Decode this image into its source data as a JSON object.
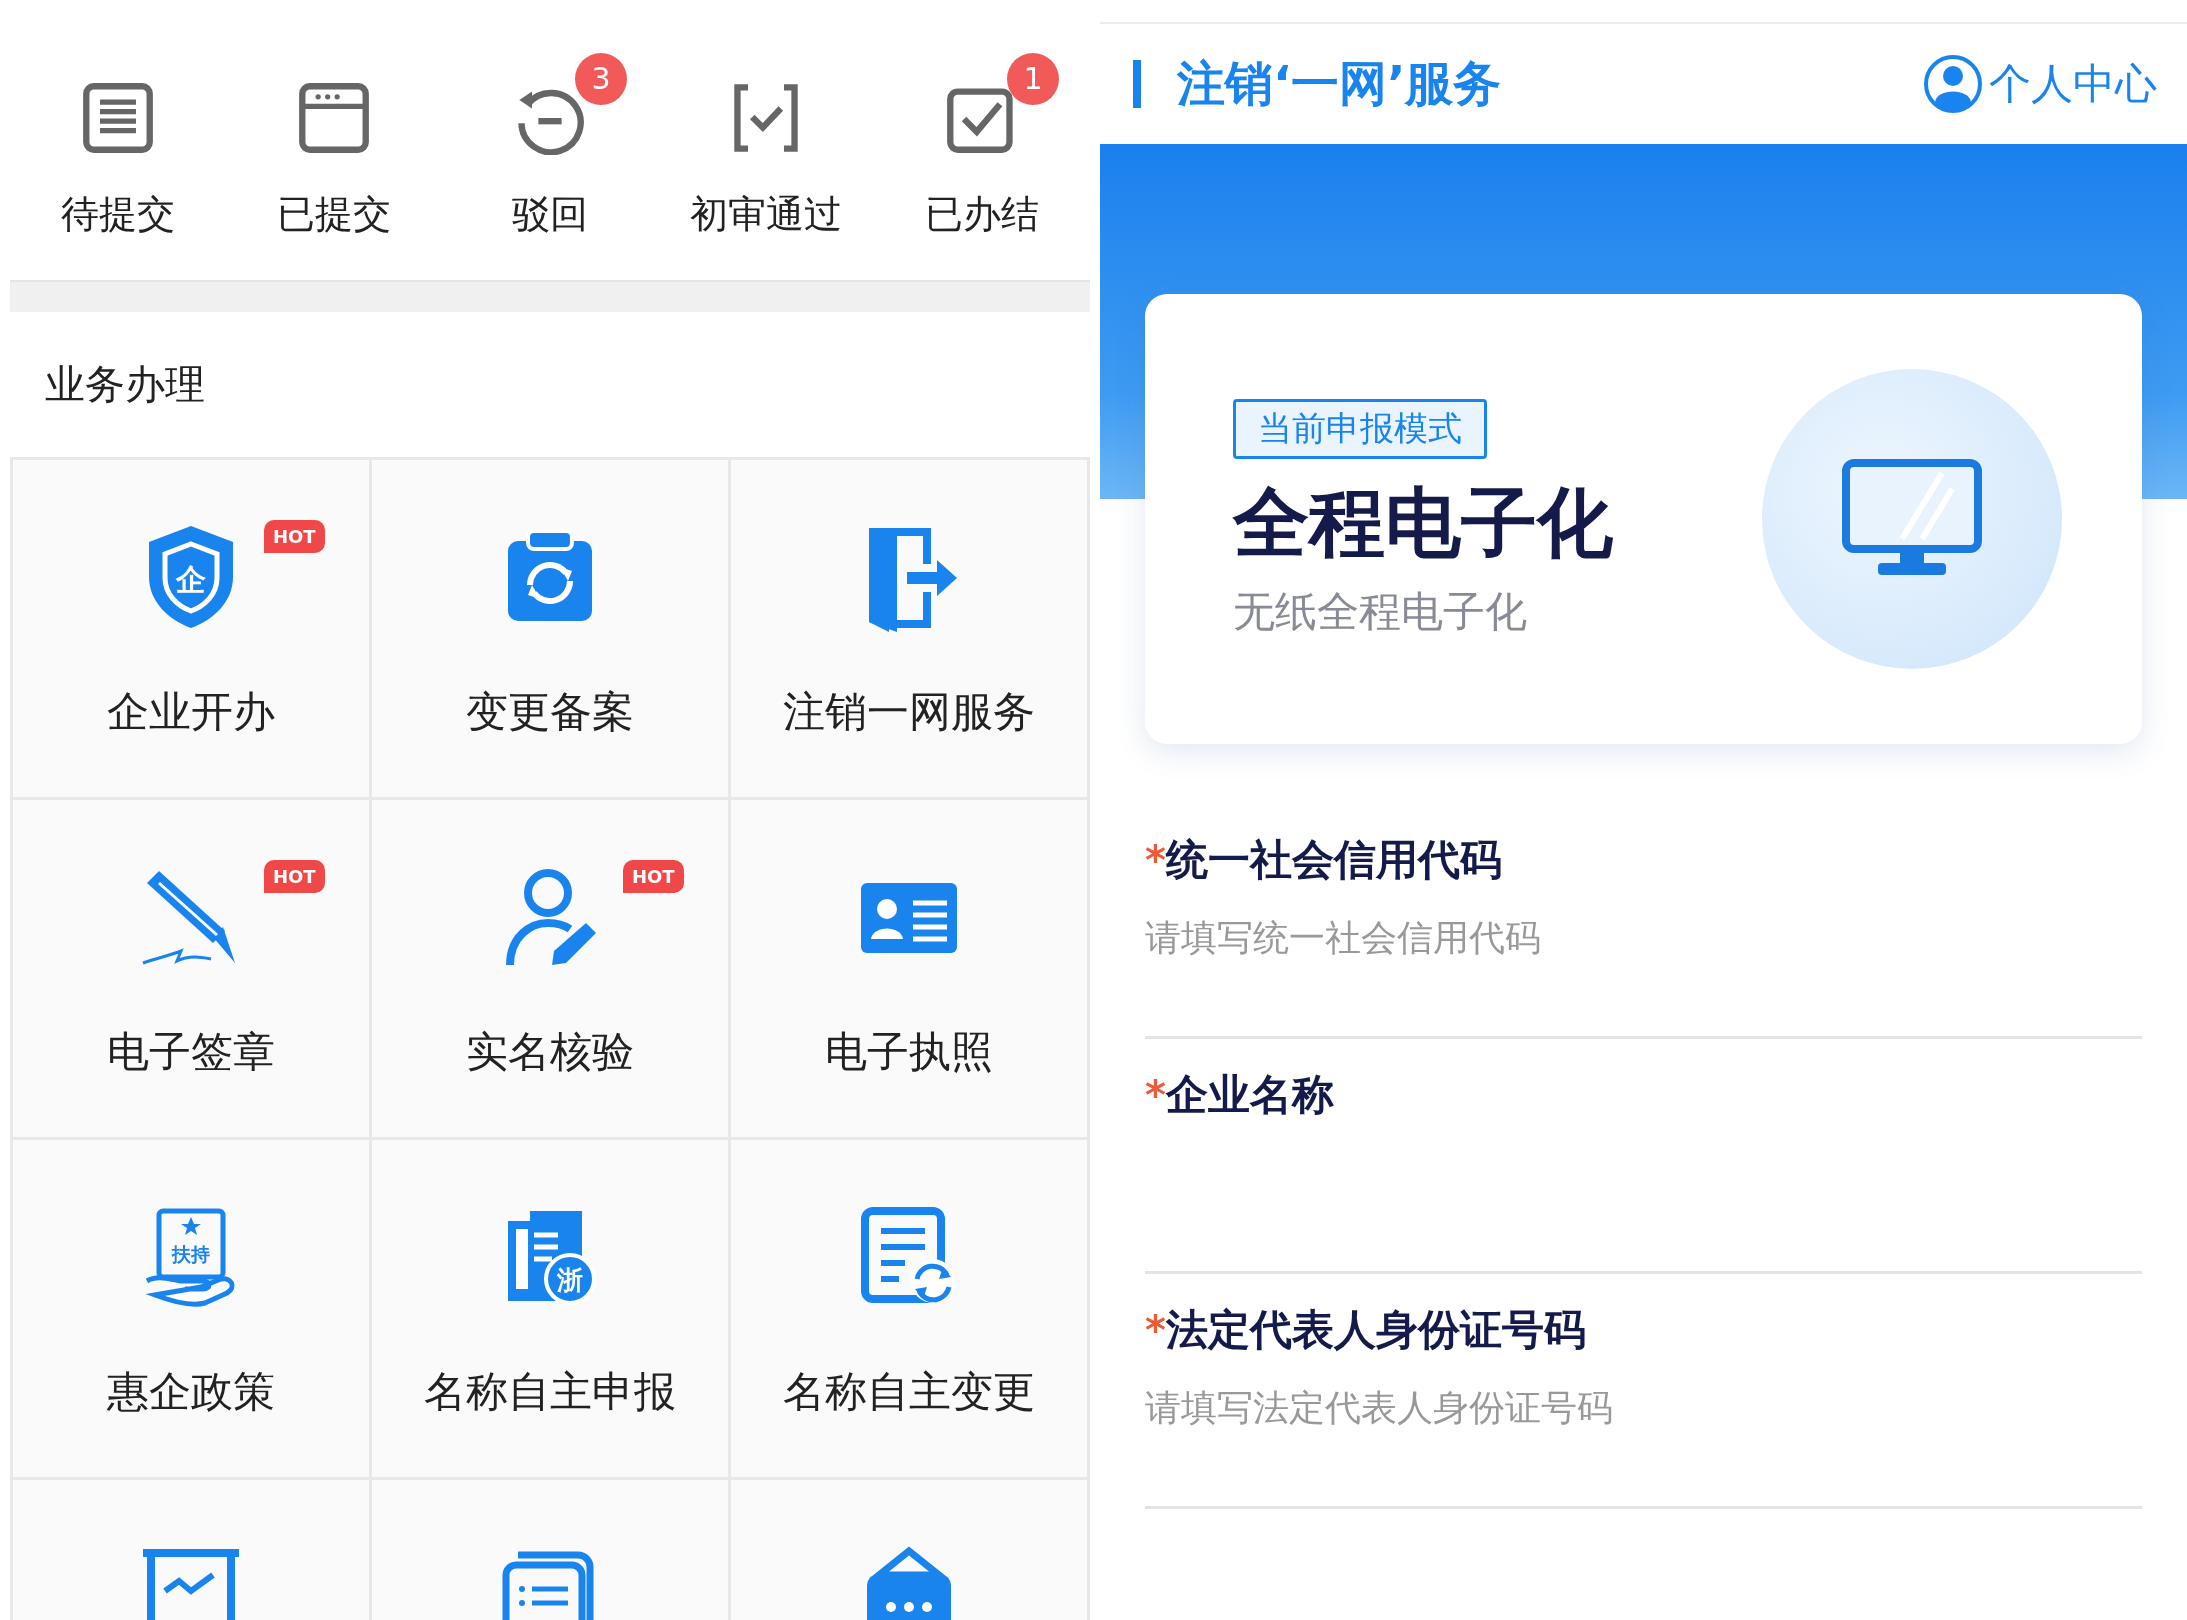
{
  "status_tabs": [
    {
      "label": "待提交"
    },
    {
      "label": "已提交"
    },
    {
      "label": "驳回",
      "count": "3"
    },
    {
      "label": "初审通过"
    },
    {
      "label": "已办结",
      "count": "1"
    }
  ],
  "section_title": "业务办理",
  "tiles": [
    {
      "label": "企业开办",
      "icon_text": "企",
      "badge": "HOT"
    },
    {
      "label": "变更备案"
    },
    {
      "label": "注销一网服务"
    },
    {
      "label": "电子签章",
      "badge": "HOT"
    },
    {
      "label": "实名核验",
      "badge": "HOT"
    },
    {
      "label": "电子执照"
    },
    {
      "label": "惠企政策",
      "icon_text": "扶持"
    },
    {
      "label": "名称自主申报",
      "icon_text": "浙"
    },
    {
      "label": "名称自主变更"
    }
  ],
  "header": {
    "title": "注销‘一网’服务",
    "user_link": "个人中心"
  },
  "mode_card": {
    "tag": "当前申报模式",
    "title": "全程电子化",
    "subtitle": "无纸全程电子化"
  },
  "fields": [
    {
      "required_mark": "*",
      "label": "统一社会信用代码",
      "placeholder": "请填写统一社会信用代码"
    },
    {
      "required_mark": "*",
      "label": "企业名称"
    },
    {
      "required_mark": "*",
      "label": "法定代表人身份证号码",
      "placeholder": "请填写法定代表人身份证号码"
    }
  ]
}
